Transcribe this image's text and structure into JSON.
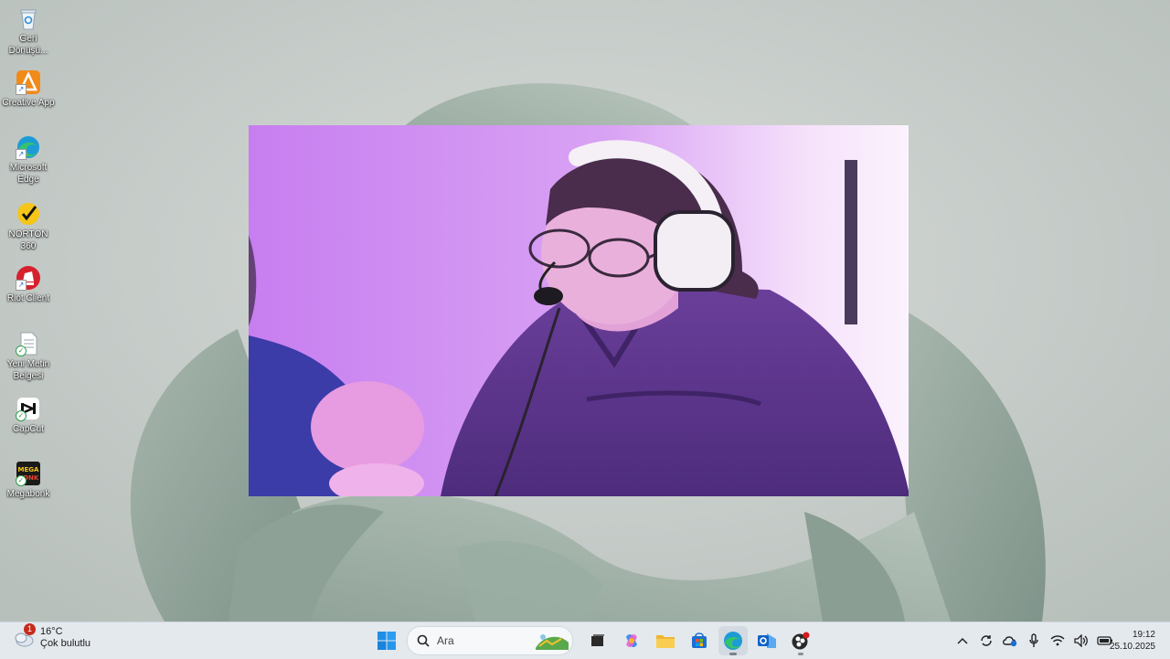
{
  "desktop": {
    "icons": [
      {
        "label": "Geri Dönüşü...",
        "icon": "recycle-bin-icon"
      },
      {
        "label": "Creative App",
        "icon": "creative-app-icon"
      },
      {
        "label": "Microsoft Edge",
        "icon": "edge-icon"
      },
      {
        "label": "NORTON 360",
        "icon": "norton-icon"
      },
      {
        "label": "Riot Client",
        "icon": "riot-client-icon"
      },
      {
        "label": "Yeni Metin Belgesi",
        "icon": "text-document-icon"
      },
      {
        "label": "CapCut",
        "icon": "capcut-icon"
      },
      {
        "label": "Megabonk",
        "icon": "megabonk-icon"
      }
    ],
    "megabonk_logo_text": "MEGA BONK"
  },
  "taskbar": {
    "weather": {
      "temperature": "16°C",
      "condition": "Çok bulutlu",
      "badge_count": "1"
    },
    "search_placeholder": "Ara",
    "apps": [
      "start-button",
      "search",
      "task-view",
      "copilot",
      "file-explorer",
      "microsoft-store",
      "edge",
      "outlook",
      "obs"
    ],
    "tray": [
      "show-hidden-icons",
      "sync",
      "onedrive",
      "microphone",
      "wifi",
      "volume",
      "battery"
    ],
    "clock": {
      "time": "19:12",
      "date": "25.10.2025"
    }
  },
  "colors": {
    "taskbar_bg": "#e4e9ee",
    "wallpaper": "#c2c8c4",
    "video_tint": "#d59cf0"
  }
}
